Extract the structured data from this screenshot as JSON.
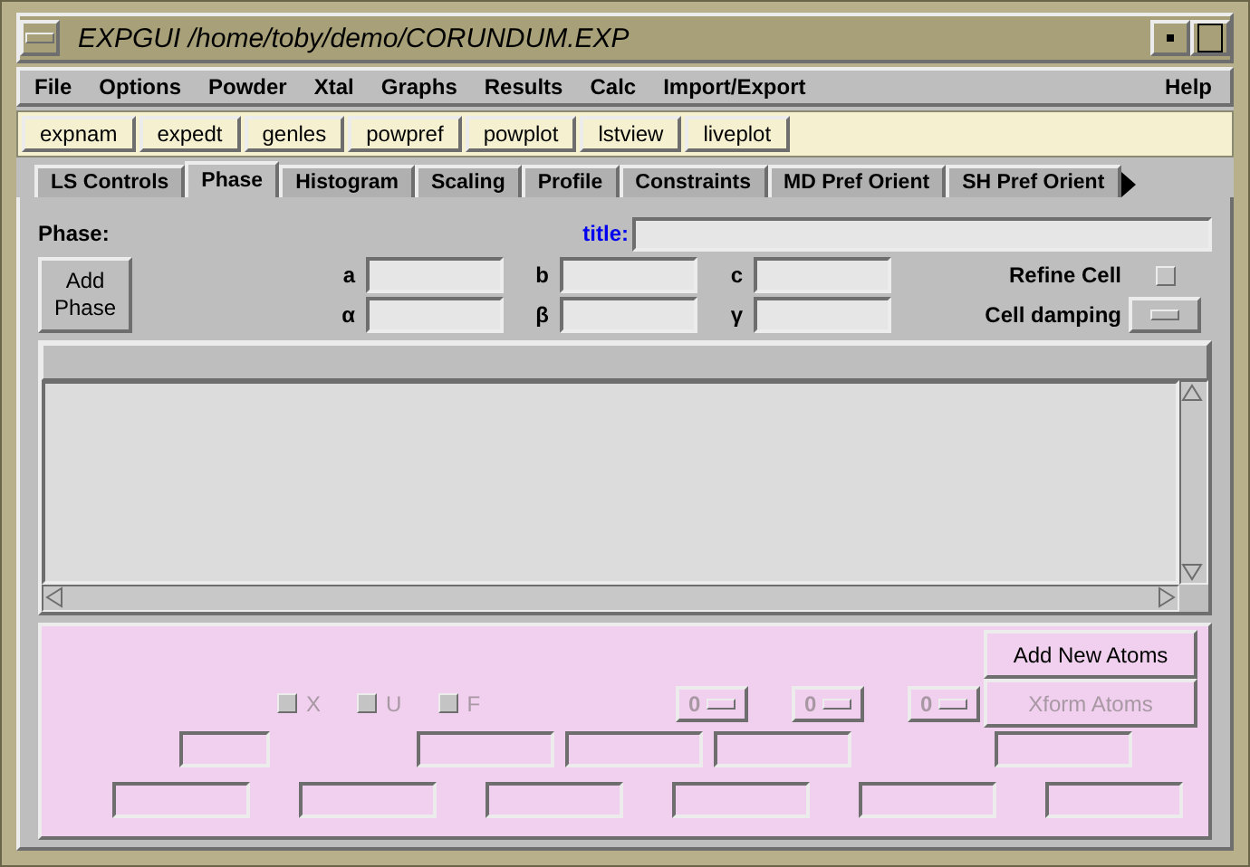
{
  "window": {
    "title": "EXPGUI /home/toby/demo/CORUNDUM.EXP"
  },
  "menu": {
    "items": [
      "File",
      "Options",
      "Powder",
      "Xtal",
      "Graphs",
      "Results",
      "Calc",
      "Import/Export"
    ],
    "help": "Help"
  },
  "toolbar": [
    "expnam",
    "expedt",
    "genles",
    "powpref",
    "powplot",
    "lstview",
    "liveplot"
  ],
  "tabs": [
    {
      "label": "LS Controls",
      "selected": false
    },
    {
      "label": "Phase",
      "selected": true
    },
    {
      "label": "Histogram",
      "selected": false
    },
    {
      "label": "Scaling",
      "selected": false
    },
    {
      "label": "Profile",
      "selected": false
    },
    {
      "label": "Constraints",
      "selected": false
    },
    {
      "label": "MD Pref Orient",
      "selected": false
    },
    {
      "label": "SH Pref Orient",
      "selected": false
    }
  ],
  "phase": {
    "label": "Phase:",
    "add_button": "Add Phase",
    "title_label": "title:",
    "cell_rows": [
      [
        "a",
        "b",
        "c"
      ],
      [
        "α",
        "β",
        "γ"
      ]
    ],
    "refine_cell": {
      "label": "Refine Cell",
      "checked": false
    },
    "cell_damping": {
      "label": "Cell damping"
    }
  },
  "atoms": {
    "add_button": "Add New Atoms",
    "xform_button": {
      "label": "Xform Atoms",
      "disabled": true
    },
    "flags": [
      {
        "label": "X",
        "checked": false,
        "disabled": true
      },
      {
        "label": "U",
        "checked": false,
        "disabled": true
      },
      {
        "label": "F",
        "checked": false,
        "disabled": true
      }
    ],
    "dampers": [
      {
        "value": "0",
        "disabled": true
      },
      {
        "value": "0",
        "disabled": true
      },
      {
        "value": "0",
        "disabled": true
      }
    ]
  }
}
